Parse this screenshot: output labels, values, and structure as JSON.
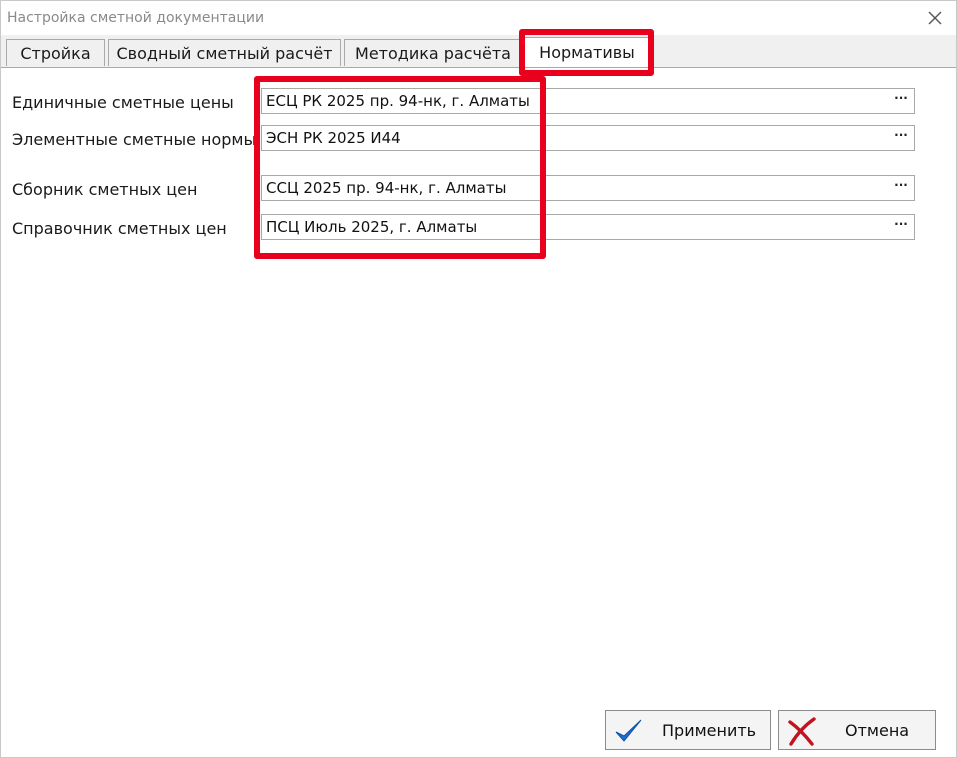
{
  "window": {
    "title": "Настройка сметной документации"
  },
  "tabs": [
    {
      "label": "Стройка"
    },
    {
      "label": "Сводный сметный расчёт"
    },
    {
      "label": "Методика расчёта"
    },
    {
      "label": "Нормативы"
    }
  ],
  "active_tab": "Нормативы",
  "rows": [
    {
      "label": "Единичные сметные цены",
      "value": "ЕСЦ РК 2025 пр. 94-нк, г. Алматы"
    },
    {
      "label": "Элементные сметные нормы",
      "value": "ЭСН РК 2025 И44"
    },
    {
      "label": "Сборник сметных цен",
      "value": "ССЦ 2025 пр. 94-нк, г. Алматы"
    },
    {
      "label": "Справочник сметных цен",
      "value": "ПСЦ Июль 2025, г. Алматы"
    }
  ],
  "ellipsis_label": "···",
  "buttons": {
    "apply_label": "Применить",
    "cancel_label": "Отмена"
  },
  "icons": {
    "close": "close-icon",
    "apply": "checkmark-icon",
    "cancel": "cross-icon"
  },
  "colors": {
    "highlight": "#e8001c",
    "check": "#1f6fd1",
    "cross": "#c0141e"
  }
}
